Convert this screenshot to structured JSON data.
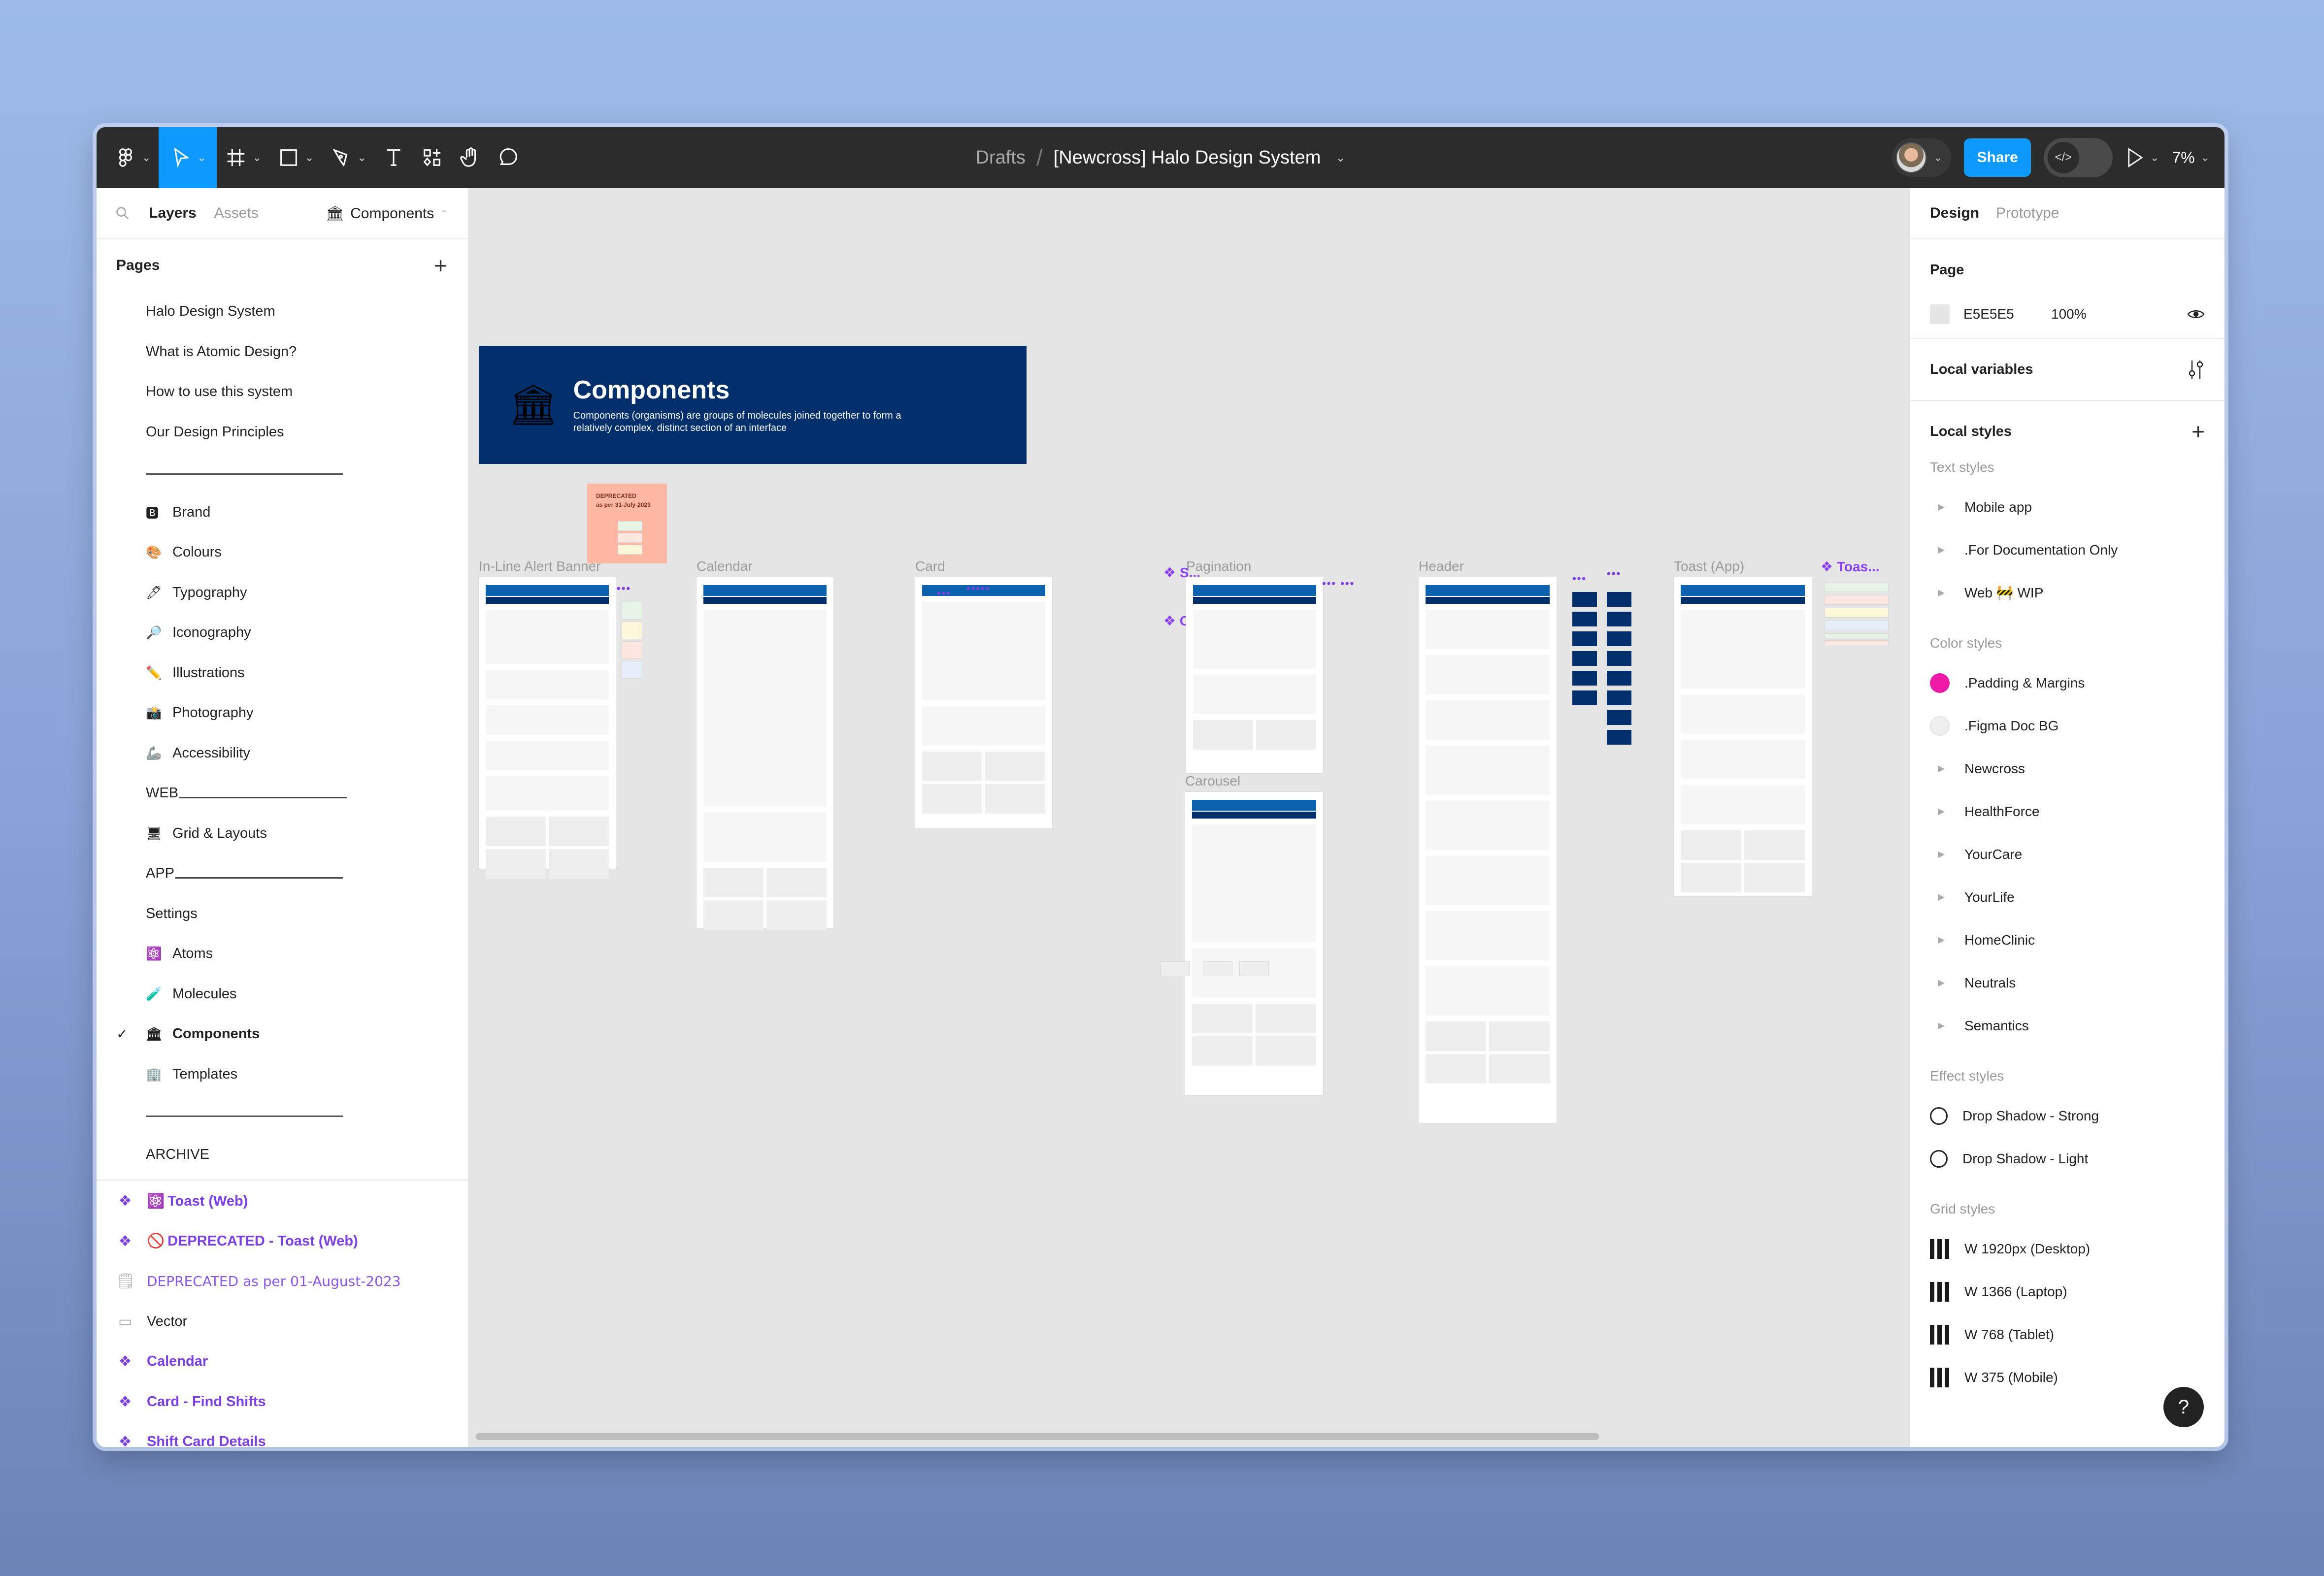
{
  "toolbar": {
    "tools": [
      {
        "name": "main-menu",
        "icon": "figma-logo-icon",
        "has_dropdown": true
      },
      {
        "name": "move",
        "icon": "cursor-arrow-icon",
        "has_dropdown": true,
        "active": true
      },
      {
        "name": "frame",
        "icon": "frame-grid-icon",
        "has_dropdown": true
      },
      {
        "name": "shape",
        "icon": "rectangle-icon",
        "has_dropdown": true
      },
      {
        "name": "pen",
        "icon": "pen-icon",
        "has_dropdown": true
      },
      {
        "name": "text",
        "icon": "text-t-icon",
        "has_dropdown": false
      },
      {
        "name": "resources",
        "icon": "resources-icon",
        "has_dropdown": false
      },
      {
        "name": "hand",
        "icon": "hand-icon",
        "has_dropdown": false
      },
      {
        "name": "comment",
        "icon": "comment-icon",
        "has_dropdown": false
      }
    ],
    "breadcrumb_parent": "Drafts",
    "breadcrumb_sep": "/",
    "file_name": "[Newcross] Halo Design System",
    "share_label": "Share",
    "dev_mode_icon": "</>",
    "zoom_level": "7%",
    "accent_color": "#0d99ff"
  },
  "left_panel": {
    "tabs": [
      {
        "label": "Layers",
        "active": true
      },
      {
        "label": "Assets",
        "active": false
      }
    ],
    "current_page_emoji": "🏛",
    "current_page": "Components",
    "pages_title": "Pages",
    "pages": [
      {
        "emoji": "",
        "label": "Halo Design System"
      },
      {
        "emoji": "",
        "label": "What is Atomic Design?"
      },
      {
        "emoji": "",
        "label": "How to use this system"
      },
      {
        "emoji": "",
        "label": "Our Design Principles"
      },
      {
        "emoji": "",
        "label": "",
        "divider": true
      },
      {
        "emoji": "🅱",
        "label": "Brand"
      },
      {
        "emoji": "🎨",
        "label": "Colours"
      },
      {
        "emoji": "🖊",
        "label": "Typography"
      },
      {
        "emoji": "🔎",
        "label": "Iconography"
      },
      {
        "emoji": "✏️",
        "label": "Illustrations"
      },
      {
        "emoji": "📸",
        "label": "Photography"
      },
      {
        "emoji": "🦾",
        "label": "Accessibility"
      },
      {
        "emoji": "",
        "label": "WEB",
        "trailing_line": true
      },
      {
        "emoji": "🖥",
        "label": "Grid & Layouts"
      },
      {
        "emoji": "",
        "label": "APP",
        "trailing_line": true
      },
      {
        "emoji": "",
        "label": "Settings"
      },
      {
        "emoji": "⚛️",
        "label": "Atoms"
      },
      {
        "emoji": "🧪",
        "label": "Molecules"
      },
      {
        "emoji": "🏛",
        "label": "Components",
        "current": true
      },
      {
        "emoji": "🏢",
        "label": "Templates"
      },
      {
        "emoji": "",
        "label": "",
        "divider": true
      },
      {
        "emoji": "",
        "label": "ARCHIVE"
      }
    ],
    "layers": [
      {
        "type": "component",
        "emoji": "⚛️",
        "label": "Toast (Web)"
      },
      {
        "type": "component",
        "emoji": "🚫",
        "label": "DEPRECATED - Toast (Web)"
      },
      {
        "type": "sticky",
        "emoji": "",
        "label": "DEPRECATED as per 01-August-2023"
      },
      {
        "type": "vector",
        "emoji": "",
        "label": "Vector"
      },
      {
        "type": "component",
        "emoji": "",
        "label": "Calendar"
      },
      {
        "type": "component",
        "emoji": "",
        "label": "Card - Find Shifts"
      },
      {
        "type": "component",
        "emoji": "",
        "label": "Shift Card Details"
      }
    ]
  },
  "canvas": {
    "background": "#e5e5e5",
    "hero": {
      "title": "Components",
      "description": "Components (organisms) are groups of molecules joined together to form a relatively complex, distinct section of an interface",
      "color": "#002f6c"
    },
    "sticky_note": {
      "line1": "DEPRECATED",
      "line2": "as per 31-July-2023"
    },
    "frames": [
      {
        "label": "In-Line Alert Banner"
      },
      {
        "label": "Calendar"
      },
      {
        "label": "Card"
      },
      {
        "label": "Pagination"
      },
      {
        "label": "Carousel"
      },
      {
        "label": "Header"
      },
      {
        "label": "Toast (App)"
      }
    ],
    "component_labels": [
      {
        "label": "S..."
      },
      {
        "label": "C..."
      },
      {
        "label": "Toas..."
      }
    ]
  },
  "right_panel": {
    "tabs": [
      {
        "label": "Design",
        "active": true
      },
      {
        "label": "Prototype",
        "active": false
      }
    ],
    "page_title": "Page",
    "page_color_hex": "E5E5E5",
    "page_opacity": "100%",
    "local_variables": "Local variables",
    "local_styles": "Local styles",
    "text_styles_label": "Text styles",
    "text_styles": [
      "Mobile app",
      ".For Documentation Only",
      "Web 🚧 WIP"
    ],
    "color_styles_label": "Color styles",
    "color_styles": [
      {
        "label": ".Padding & Margins",
        "swatch": "#ee1aa8"
      },
      {
        "label": ".Figma Doc BG",
        "swatch": "#efefef"
      },
      {
        "label": "Newcross",
        "group": true
      },
      {
        "label": "HealthForce",
        "group": true
      },
      {
        "label": "YourCare",
        "group": true
      },
      {
        "label": "YourLife",
        "group": true
      },
      {
        "label": "HomeClinic",
        "group": true
      },
      {
        "label": "Neutrals",
        "group": true
      },
      {
        "label": "Semantics",
        "group": true
      }
    ],
    "effect_styles_label": "Effect styles",
    "effect_styles": [
      "Drop Shadow - Strong",
      "Drop Shadow - Light"
    ],
    "grid_styles_label": "Grid styles",
    "grid_styles": [
      "W 1920px (Desktop)",
      "W 1366 (Laptop)",
      "W 768 (Tablet)",
      "W 375 (Mobile)"
    ],
    "help_label": "?"
  }
}
